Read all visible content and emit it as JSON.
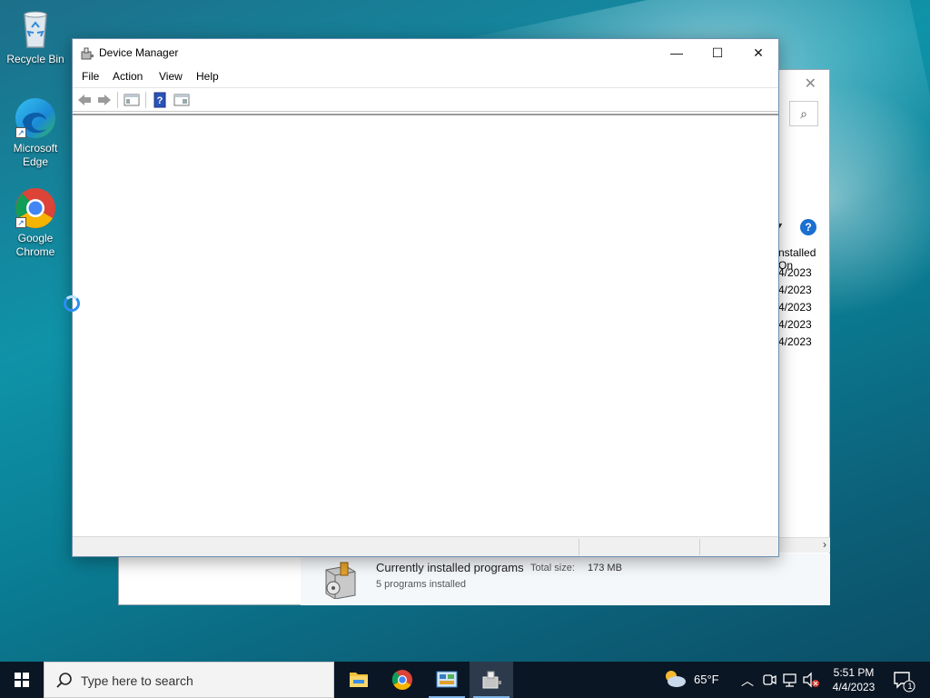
{
  "desktop": {
    "icons": [
      {
        "label": "Recycle Bin"
      },
      {
        "label": "Microsoft Edge"
      },
      {
        "label": "Google Chrome"
      }
    ]
  },
  "background_window": {
    "column_header": "nstalled On",
    "dates": [
      "4/2023",
      "4/2023",
      "4/2023",
      "4/2023",
      "4/2023"
    ],
    "status": {
      "title": "Currently installed programs",
      "total_size_label": "Total size:",
      "total_size_value": "173 MB",
      "count_text": "5 programs installed"
    }
  },
  "device_manager": {
    "title": "Device Manager",
    "menu": [
      "File",
      "Action",
      "View",
      "Help"
    ],
    "window_buttons": {
      "minimize": "—",
      "maximize": "☐",
      "close": "✕"
    }
  },
  "taskbar": {
    "search_placeholder": "Type here to search",
    "weather": "65°F",
    "time": "5:51 PM",
    "date": "4/4/2023",
    "notification_count": "1"
  },
  "colors": {
    "accent": "#1a6fd0",
    "taskbar": "#0b1624",
    "spinner": "#2d8ef0"
  }
}
